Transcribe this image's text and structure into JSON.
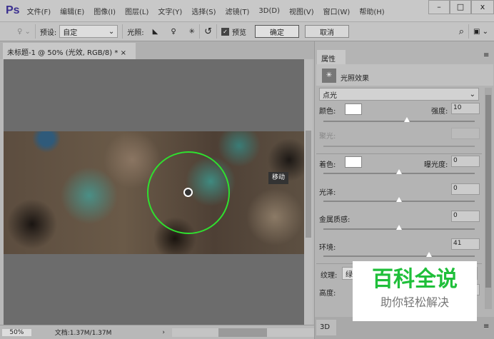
{
  "app": {
    "logo": "Ps"
  },
  "menu": [
    "文件(F)",
    "编辑(E)",
    "图像(I)",
    "图层(L)",
    "文字(Y)",
    "选择(S)",
    "滤镜(T)",
    "3D(D)",
    "视图(V)",
    "窗口(W)",
    "帮助(H)"
  ],
  "window": {
    "minimize": "–",
    "maximize": "□",
    "close": "x"
  },
  "options": {
    "preset_label": "预设:",
    "preset_value": "自定",
    "lighting_label": "光照:",
    "preview_label": "预览",
    "ok": "确定",
    "cancel": "取消"
  },
  "document": {
    "tab": "未标题-1 @ 50% (光效, RGB/8) *",
    "close": "×",
    "tooltip": "移动"
  },
  "status": {
    "zoom": "50%",
    "doc": "文档:1.37M/1.37M"
  },
  "panel": {
    "tab": "属性",
    "title": "光照效果",
    "light_type": "点光",
    "color_label": "颜色:",
    "intensity_label": "强度:",
    "intensity": "10",
    "hotspot_label": "聚光:",
    "colorize_label": "着色:",
    "exposure_label": "曝光度:",
    "exposure": "0",
    "gloss_label": "光泽:",
    "gloss": "0",
    "metallic_label": "金属质感:",
    "metallic": "0",
    "ambience_label": "环境:",
    "ambience": "41",
    "texture_label": "纹理:",
    "texture_value": "绿",
    "height_label": "高度:",
    "bottom_tab": "3D"
  },
  "sliders": {
    "intensity": 0.55,
    "exposure": 0.5,
    "gloss": 0.5,
    "metallic": 0.5,
    "ambience": 0.7
  },
  "watermark": {
    "title": "百科全说",
    "subtitle": "助你轻松解决"
  }
}
